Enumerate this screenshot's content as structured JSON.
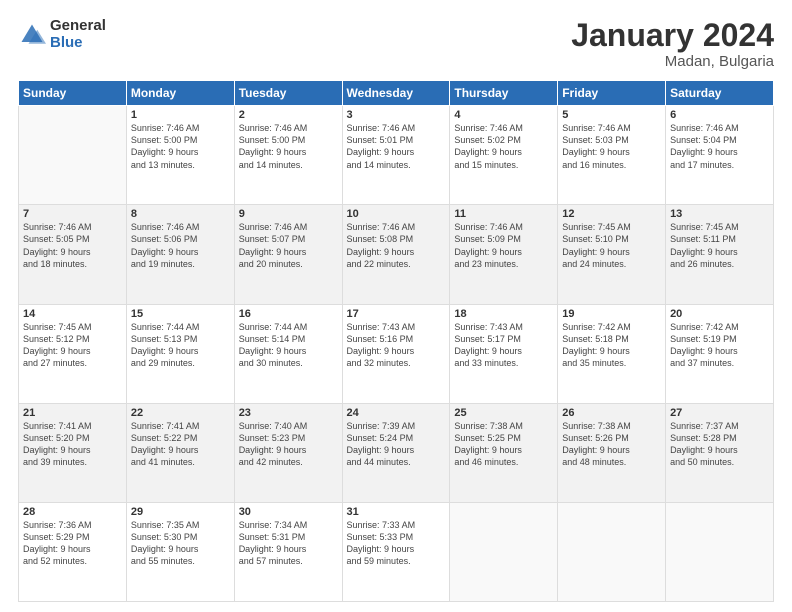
{
  "logo": {
    "general": "General",
    "blue": "Blue"
  },
  "header": {
    "month": "January 2024",
    "location": "Madan, Bulgaria"
  },
  "weekdays": [
    "Sunday",
    "Monday",
    "Tuesday",
    "Wednesday",
    "Thursday",
    "Friday",
    "Saturday"
  ],
  "weeks": [
    {
      "shaded": false,
      "days": [
        {
          "num": "",
          "info": ""
        },
        {
          "num": "1",
          "info": "Sunrise: 7:46 AM\nSunset: 5:00 PM\nDaylight: 9 hours\nand 13 minutes."
        },
        {
          "num": "2",
          "info": "Sunrise: 7:46 AM\nSunset: 5:00 PM\nDaylight: 9 hours\nand 14 minutes."
        },
        {
          "num": "3",
          "info": "Sunrise: 7:46 AM\nSunset: 5:01 PM\nDaylight: 9 hours\nand 14 minutes."
        },
        {
          "num": "4",
          "info": "Sunrise: 7:46 AM\nSunset: 5:02 PM\nDaylight: 9 hours\nand 15 minutes."
        },
        {
          "num": "5",
          "info": "Sunrise: 7:46 AM\nSunset: 5:03 PM\nDaylight: 9 hours\nand 16 minutes."
        },
        {
          "num": "6",
          "info": "Sunrise: 7:46 AM\nSunset: 5:04 PM\nDaylight: 9 hours\nand 17 minutes."
        }
      ]
    },
    {
      "shaded": true,
      "days": [
        {
          "num": "7",
          "info": "Sunrise: 7:46 AM\nSunset: 5:05 PM\nDaylight: 9 hours\nand 18 minutes."
        },
        {
          "num": "8",
          "info": "Sunrise: 7:46 AM\nSunset: 5:06 PM\nDaylight: 9 hours\nand 19 minutes."
        },
        {
          "num": "9",
          "info": "Sunrise: 7:46 AM\nSunset: 5:07 PM\nDaylight: 9 hours\nand 20 minutes."
        },
        {
          "num": "10",
          "info": "Sunrise: 7:46 AM\nSunset: 5:08 PM\nDaylight: 9 hours\nand 22 minutes."
        },
        {
          "num": "11",
          "info": "Sunrise: 7:46 AM\nSunset: 5:09 PM\nDaylight: 9 hours\nand 23 minutes."
        },
        {
          "num": "12",
          "info": "Sunrise: 7:45 AM\nSunset: 5:10 PM\nDaylight: 9 hours\nand 24 minutes."
        },
        {
          "num": "13",
          "info": "Sunrise: 7:45 AM\nSunset: 5:11 PM\nDaylight: 9 hours\nand 26 minutes."
        }
      ]
    },
    {
      "shaded": false,
      "days": [
        {
          "num": "14",
          "info": "Sunrise: 7:45 AM\nSunset: 5:12 PM\nDaylight: 9 hours\nand 27 minutes."
        },
        {
          "num": "15",
          "info": "Sunrise: 7:44 AM\nSunset: 5:13 PM\nDaylight: 9 hours\nand 29 minutes."
        },
        {
          "num": "16",
          "info": "Sunrise: 7:44 AM\nSunset: 5:14 PM\nDaylight: 9 hours\nand 30 minutes."
        },
        {
          "num": "17",
          "info": "Sunrise: 7:43 AM\nSunset: 5:16 PM\nDaylight: 9 hours\nand 32 minutes."
        },
        {
          "num": "18",
          "info": "Sunrise: 7:43 AM\nSunset: 5:17 PM\nDaylight: 9 hours\nand 33 minutes."
        },
        {
          "num": "19",
          "info": "Sunrise: 7:42 AM\nSunset: 5:18 PM\nDaylight: 9 hours\nand 35 minutes."
        },
        {
          "num": "20",
          "info": "Sunrise: 7:42 AM\nSunset: 5:19 PM\nDaylight: 9 hours\nand 37 minutes."
        }
      ]
    },
    {
      "shaded": true,
      "days": [
        {
          "num": "21",
          "info": "Sunrise: 7:41 AM\nSunset: 5:20 PM\nDaylight: 9 hours\nand 39 minutes."
        },
        {
          "num": "22",
          "info": "Sunrise: 7:41 AM\nSunset: 5:22 PM\nDaylight: 9 hours\nand 41 minutes."
        },
        {
          "num": "23",
          "info": "Sunrise: 7:40 AM\nSunset: 5:23 PM\nDaylight: 9 hours\nand 42 minutes."
        },
        {
          "num": "24",
          "info": "Sunrise: 7:39 AM\nSunset: 5:24 PM\nDaylight: 9 hours\nand 44 minutes."
        },
        {
          "num": "25",
          "info": "Sunrise: 7:38 AM\nSunset: 5:25 PM\nDaylight: 9 hours\nand 46 minutes."
        },
        {
          "num": "26",
          "info": "Sunrise: 7:38 AM\nSunset: 5:26 PM\nDaylight: 9 hours\nand 48 minutes."
        },
        {
          "num": "27",
          "info": "Sunrise: 7:37 AM\nSunset: 5:28 PM\nDaylight: 9 hours\nand 50 minutes."
        }
      ]
    },
    {
      "shaded": false,
      "days": [
        {
          "num": "28",
          "info": "Sunrise: 7:36 AM\nSunset: 5:29 PM\nDaylight: 9 hours\nand 52 minutes."
        },
        {
          "num": "29",
          "info": "Sunrise: 7:35 AM\nSunset: 5:30 PM\nDaylight: 9 hours\nand 55 minutes."
        },
        {
          "num": "30",
          "info": "Sunrise: 7:34 AM\nSunset: 5:31 PM\nDaylight: 9 hours\nand 57 minutes."
        },
        {
          "num": "31",
          "info": "Sunrise: 7:33 AM\nSunset: 5:33 PM\nDaylight: 9 hours\nand 59 minutes."
        },
        {
          "num": "",
          "info": ""
        },
        {
          "num": "",
          "info": ""
        },
        {
          "num": "",
          "info": ""
        }
      ]
    }
  ]
}
